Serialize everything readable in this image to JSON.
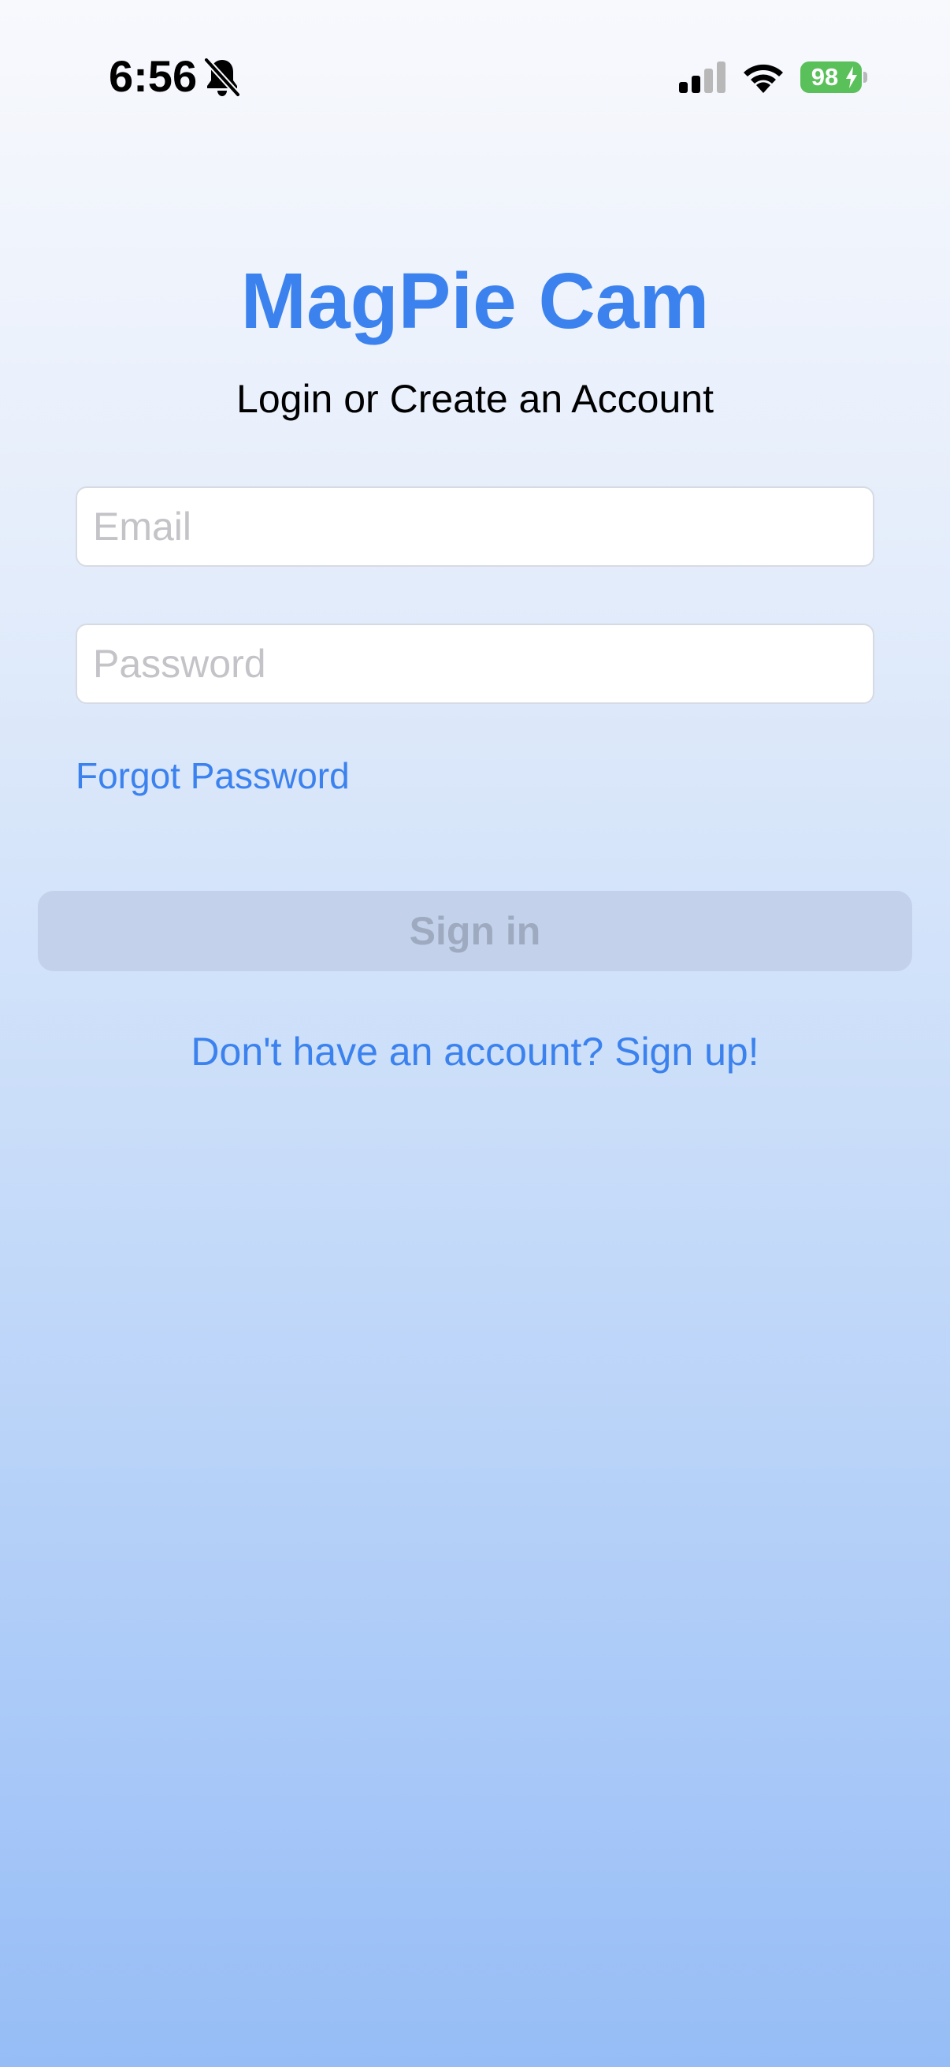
{
  "status_bar": {
    "time": "6:56",
    "battery_level": "98",
    "battery_color": "#5ac05a",
    "icons": [
      "bell-slash-icon",
      "cellular-signal-icon",
      "wifi-icon",
      "battery-icon",
      "charging-bolt-icon"
    ]
  },
  "app": {
    "title": "MagPie Cam",
    "subtitle": "Login or Create an Account",
    "accent_color": "#3b82ef"
  },
  "form": {
    "email_placeholder": "Email",
    "email_value": "",
    "password_placeholder": "Password",
    "password_value": "",
    "forgot_password_label": "Forgot Password",
    "sign_in_label": "Sign in",
    "sign_up_label": "Don't have an account? Sign up!"
  }
}
